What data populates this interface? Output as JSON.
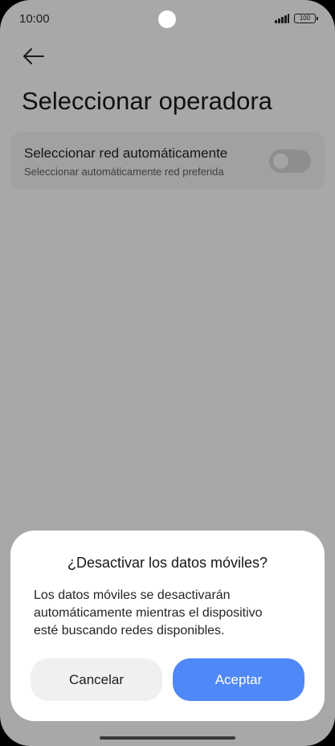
{
  "status_bar": {
    "time": "10:00",
    "battery_level": "100"
  },
  "header": {
    "back_icon": "arrow-left-icon",
    "title": "Seleccionar operadora"
  },
  "setting": {
    "title": "Seleccionar red automáticamente",
    "subtitle": "Seleccionar automáticamente red preferida",
    "toggle_on": false
  },
  "dialog": {
    "title": "¿Desactivar los datos móviles?",
    "message_lines": [
      "Los datos móviles se desactivarán",
      "automáticamente mientras el dispositivo",
      "esté buscando redes disponibles."
    ],
    "cancel_label": "Cancelar",
    "accept_label": "Aceptar"
  },
  "colors": {
    "accent": "#4f88f7",
    "scrim": "#a8a8a8"
  }
}
